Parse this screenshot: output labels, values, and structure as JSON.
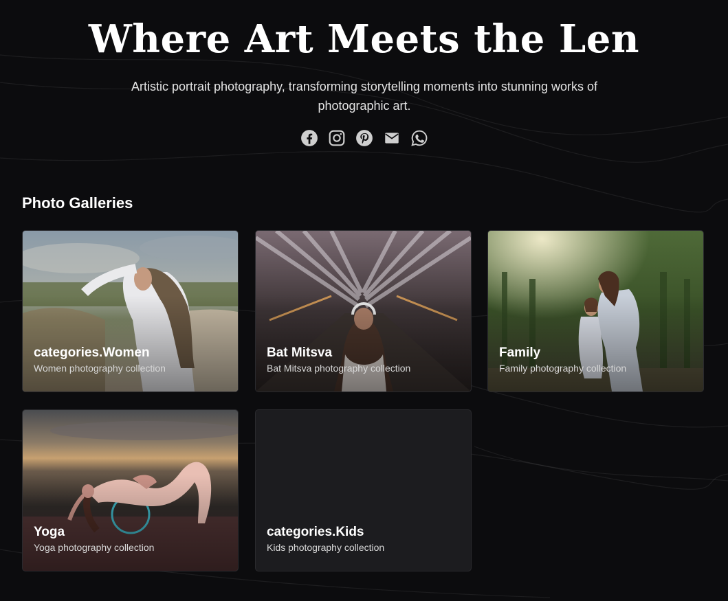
{
  "hero": {
    "title": "Where Art Meets the Len",
    "subtitle": "Artistic portrait photography, transforming storytelling moments into stunning works of photographic art."
  },
  "social": [
    {
      "icon": "facebook-icon"
    },
    {
      "icon": "instagram-icon"
    },
    {
      "icon": "pinterest-icon"
    },
    {
      "icon": "email-icon"
    },
    {
      "icon": "whatsapp-icon"
    }
  ],
  "galleries": {
    "heading": "Photo Galleries",
    "cards": [
      {
        "title": "categories.Women",
        "description": "Women photography collection"
      },
      {
        "title": "Bat Mitsva",
        "description": "Bat Mitsva photography collection"
      },
      {
        "title": "Family",
        "description": "Family photography collection"
      },
      {
        "title": "Yoga",
        "description": "Yoga photography collection"
      },
      {
        "title": "categories.Kids",
        "description": "Kids photography collection"
      }
    ]
  },
  "colors": {
    "background": "#0c0c0e",
    "card_empty": "#1c1c1f",
    "icon": "#cfcfcf"
  }
}
